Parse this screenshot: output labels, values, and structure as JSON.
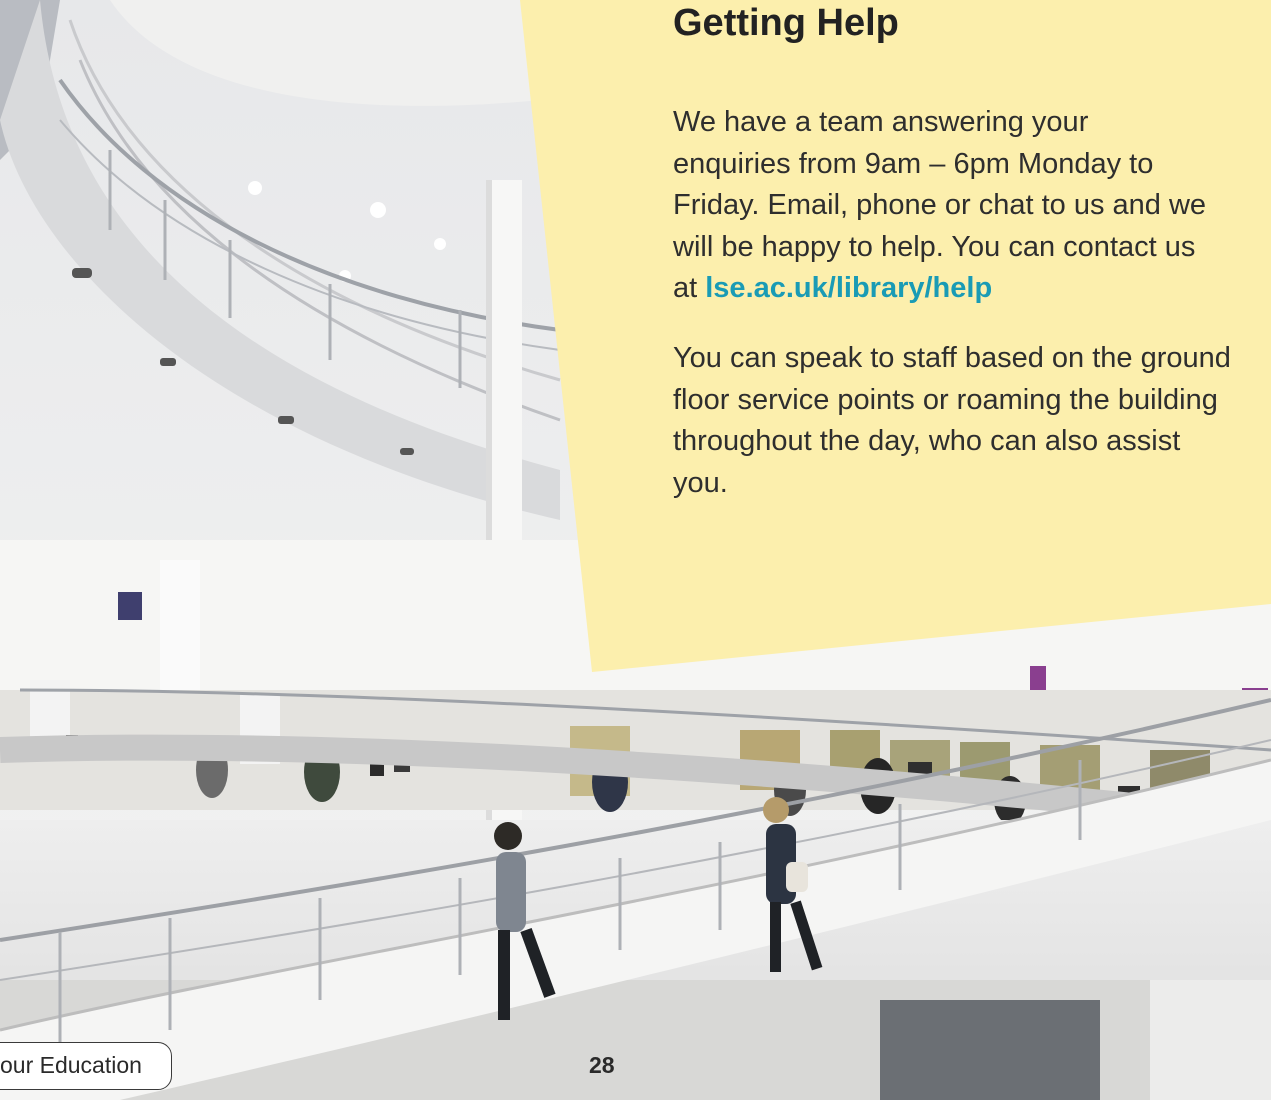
{
  "section": {
    "heading": "Getting Help",
    "paragraph_1_text": "We have a team answering your enquiries from 9am – 6pm Monday to Friday. Email, phone or chat to us and we will be happy to help. You can contact us at ",
    "paragraph_1_link": "lse.ac.uk/library/help",
    "paragraph_2": "You can speak to staff based on the ground floor service points or roaming the building throughout the day, who can also assist you."
  },
  "footer": {
    "label": "our Education",
    "page_number": "28"
  },
  "colors": {
    "panel_background": "#fcefad",
    "link": "#1a9bb5"
  }
}
